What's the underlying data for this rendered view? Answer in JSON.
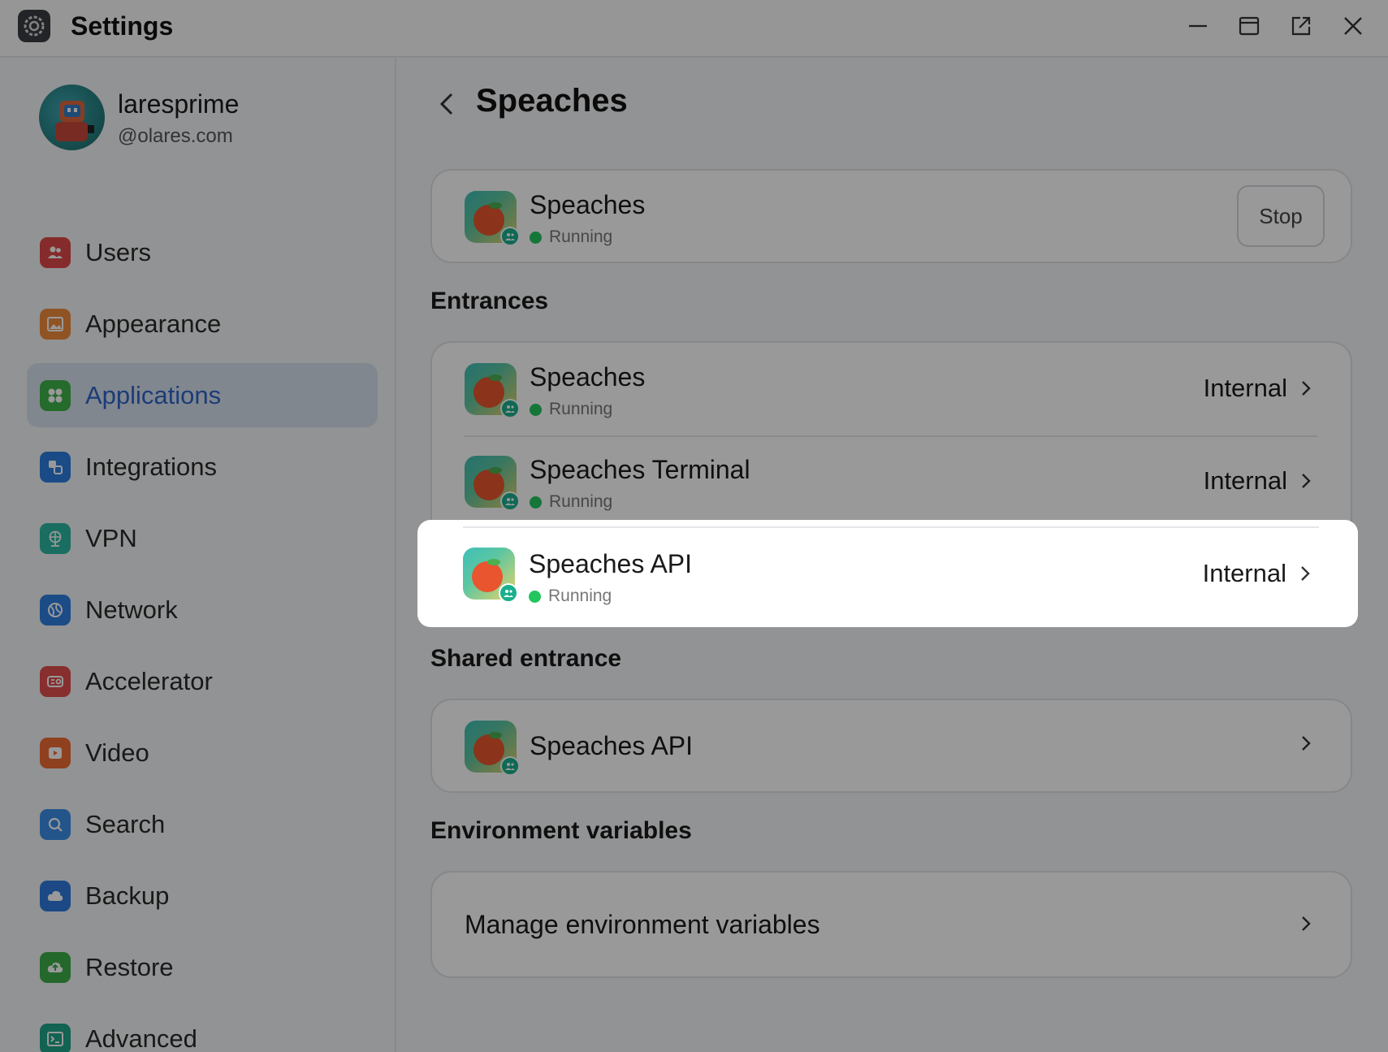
{
  "window": {
    "title": "Settings"
  },
  "profile": {
    "name": "laresprime",
    "domain": "@olares.com"
  },
  "sidebar": {
    "items": [
      {
        "label": "Users",
        "color": "#e04848",
        "icon": "users-icon"
      },
      {
        "label": "Appearance",
        "color": "#f08a3c",
        "icon": "image-icon"
      },
      {
        "label": "Applications",
        "color": "#3fb24a",
        "icon": "apps-icon",
        "active": true
      },
      {
        "label": "Integrations",
        "color": "#2e7ee0",
        "icon": "integrations-icon"
      },
      {
        "label": "VPN",
        "color": "#2cb8a2",
        "icon": "vpn-icon"
      },
      {
        "label": "Network",
        "color": "#2f7fe0",
        "icon": "network-icon"
      },
      {
        "label": "Accelerator",
        "color": "#e24e4e",
        "icon": "gpu-icon"
      },
      {
        "label": "Video",
        "color": "#ef6b34",
        "icon": "video-icon"
      },
      {
        "label": "Search",
        "color": "#3b8ee6",
        "icon": "search-icon"
      },
      {
        "label": "Backup",
        "color": "#2f7ae0",
        "icon": "cloud-icon"
      },
      {
        "label": "Restore",
        "color": "#3cad49",
        "icon": "restore-icon"
      },
      {
        "label": "Advanced",
        "color": "#1fa587",
        "icon": "terminal-icon"
      }
    ]
  },
  "main": {
    "title": "Speaches",
    "app": {
      "name": "Speaches",
      "status": "Running",
      "stop_label": "Stop"
    },
    "entrances_heading": "Entrances",
    "entrances": [
      {
        "name": "Speaches",
        "status": "Running",
        "access": "Internal"
      },
      {
        "name": "Speaches Terminal",
        "status": "Running",
        "access": "Internal"
      },
      {
        "name": "Speaches API",
        "status": "Running",
        "access": "Internal"
      }
    ],
    "shared_heading": "Shared entrance",
    "shared": {
      "name": "Speaches API"
    },
    "env_heading": "Environment variables",
    "env_link": "Manage environment variables"
  },
  "colors": {
    "accent": "#2f64c8",
    "running": "#22c55e",
    "active_bg": "#d8e1ef"
  }
}
